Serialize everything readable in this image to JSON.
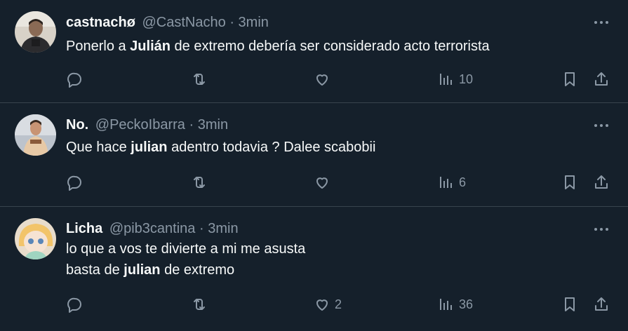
{
  "tweets": [
    {
      "name": "castnachø",
      "handle": "@CastNacho",
      "sep": "·",
      "time": "3min",
      "lines": [
        [
          {
            "t": "Ponerlo a ",
            "b": false
          },
          {
            "t": "Julián",
            "b": true
          },
          {
            "t": " de extremo debería ser considerado acto terrorista",
            "b": false
          }
        ]
      ],
      "likes": "",
      "views": "10"
    },
    {
      "name": "No.",
      "handle": "@PeckoIbarra",
      "sep": "·",
      "time": "3min",
      "lines": [
        [
          {
            "t": "Que hace ",
            "b": false
          },
          {
            "t": "julian",
            "b": true
          },
          {
            "t": " adentro todavia ? Dalee scabobii",
            "b": false
          }
        ]
      ],
      "likes": "",
      "views": "6"
    },
    {
      "name": "Licha",
      "handle": "@pib3cantina",
      "sep": "·",
      "time": "3min",
      "lines": [
        [
          {
            "t": "lo que a vos te divierte a mi me asusta",
            "b": false
          }
        ],
        [
          {
            "t": "basta de ",
            "b": false
          },
          {
            "t": "julian",
            "b": true
          },
          {
            "t": " de extremo",
            "b": false
          }
        ]
      ],
      "likes": "2",
      "views": "36"
    }
  ],
  "icons": {
    "reply": "reply-icon",
    "retweet": "retweet-icon",
    "like": "heart-icon",
    "views": "views-icon",
    "bookmark": "bookmark-icon",
    "share": "share-icon",
    "more": "more-icon"
  },
  "colors": {
    "background": "#15202b",
    "text": "#f7f9f9",
    "secondary": "#8b98a5",
    "divider": "#38444d"
  }
}
